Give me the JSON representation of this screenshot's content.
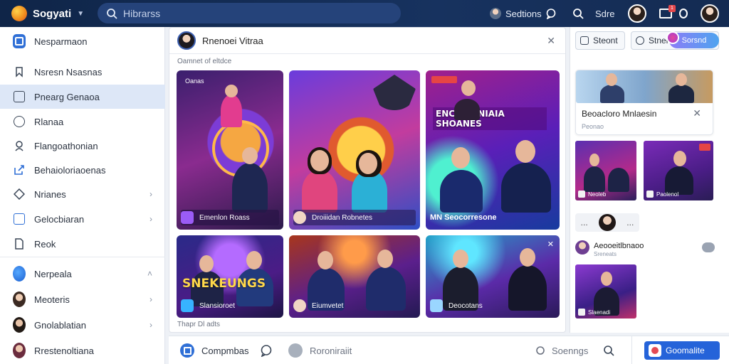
{
  "topbar": {
    "brand": "Sogyati",
    "search_placeholder": "Hibrarss",
    "item_sectors": "Sedtions",
    "item_store": "Sdre",
    "notif_count": "1"
  },
  "sidebar": {
    "items": [
      {
        "label": "Nesparmaon",
        "icon": "app-icon"
      },
      {
        "label": "Nsresn Nsasnas",
        "icon": "bookmark-icon"
      },
      {
        "label": "Pnearg Genaoa",
        "icon": "square-icon"
      },
      {
        "label": "Rlanaa",
        "icon": "globe-icon"
      },
      {
        "label": "Flangoathonian",
        "icon": "person-icon"
      },
      {
        "label": "Behaioloriaoenas",
        "icon": "share-icon"
      },
      {
        "label": "Nrianes",
        "icon": "diamond-icon"
      },
      {
        "label": "Gelocbiaran",
        "icon": "checkbox-icon"
      },
      {
        "label": "Reok",
        "icon": "file-icon"
      },
      {
        "label": "Nerpeala",
        "icon": "avatar"
      },
      {
        "label": "Meoteris",
        "icon": "avatar"
      },
      {
        "label": "Gnolablatian",
        "icon": "avatar"
      },
      {
        "label": "Rrestenoltiana",
        "icon": "avatar"
      }
    ]
  },
  "center": {
    "title": "Rnenoei Vitraa",
    "subtitle": "Oamnet of eltdce",
    "footer_note": "Thapr Dl adts",
    "cards": [
      {
        "badge": "Oanas",
        "caption": "Emenlon Roass",
        "banner": ""
      },
      {
        "badge": "",
        "caption": "Droiiidan Robnetes",
        "banner": ""
      },
      {
        "badge": "",
        "caption": "MN Seocorresone",
        "banner": "ENCEOIANIAIA SHOANES"
      },
      {
        "badge": "",
        "caption": "Slansioroet",
        "banner": "SNEKEUNGS"
      },
      {
        "badge": "",
        "caption": "Eiumvetet",
        "banner": ""
      },
      {
        "badge": "",
        "caption": "Deocotans",
        "banner": ""
      }
    ]
  },
  "right": {
    "btn1": "Steont",
    "btn2": "Stner",
    "pill": "Sorsnd",
    "card_title": "Beoacloro Mnlaesin",
    "card_sub": "Peonao",
    "mini1": "Neoleb",
    "mini2": "Paolenol",
    "typing": "...",
    "comment_name": "Aeooeitlbnaoo",
    "comment_sub": "Sreneats",
    "mini3": "Slaenadi"
  },
  "bottombar": {
    "item1": "Compmbas",
    "item2": "Roroniraiit",
    "item3": "Soenngs",
    "share": "Goomalite"
  }
}
